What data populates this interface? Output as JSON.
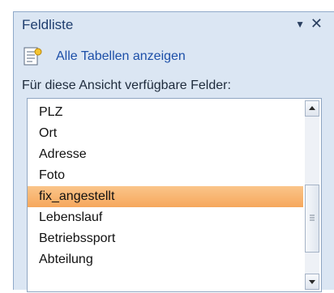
{
  "pane": {
    "title": "Feldliste",
    "menu_icon": "dropdown-arrow-icon",
    "close_icon": "close-icon"
  },
  "show_all": {
    "icon": "table-list-icon",
    "label": "Alle Tabellen anzeigen"
  },
  "caption": "Für diese Ansicht verfügbare Felder:",
  "fields": {
    "items": [
      {
        "label": "PLZ"
      },
      {
        "label": "Ort"
      },
      {
        "label": "Adresse"
      },
      {
        "label": "Foto"
      },
      {
        "label": "fix_angestellt"
      },
      {
        "label": "Lebenslauf"
      },
      {
        "label": "Betriebssport"
      },
      {
        "label": "Abteilung"
      }
    ],
    "selected": "fix_angestellt"
  },
  "colors": {
    "pane_background": "#dbe6f3",
    "title_text": "#1f3e6f",
    "link_text": "#1c4fa8",
    "selection": "#f6a75c"
  }
}
